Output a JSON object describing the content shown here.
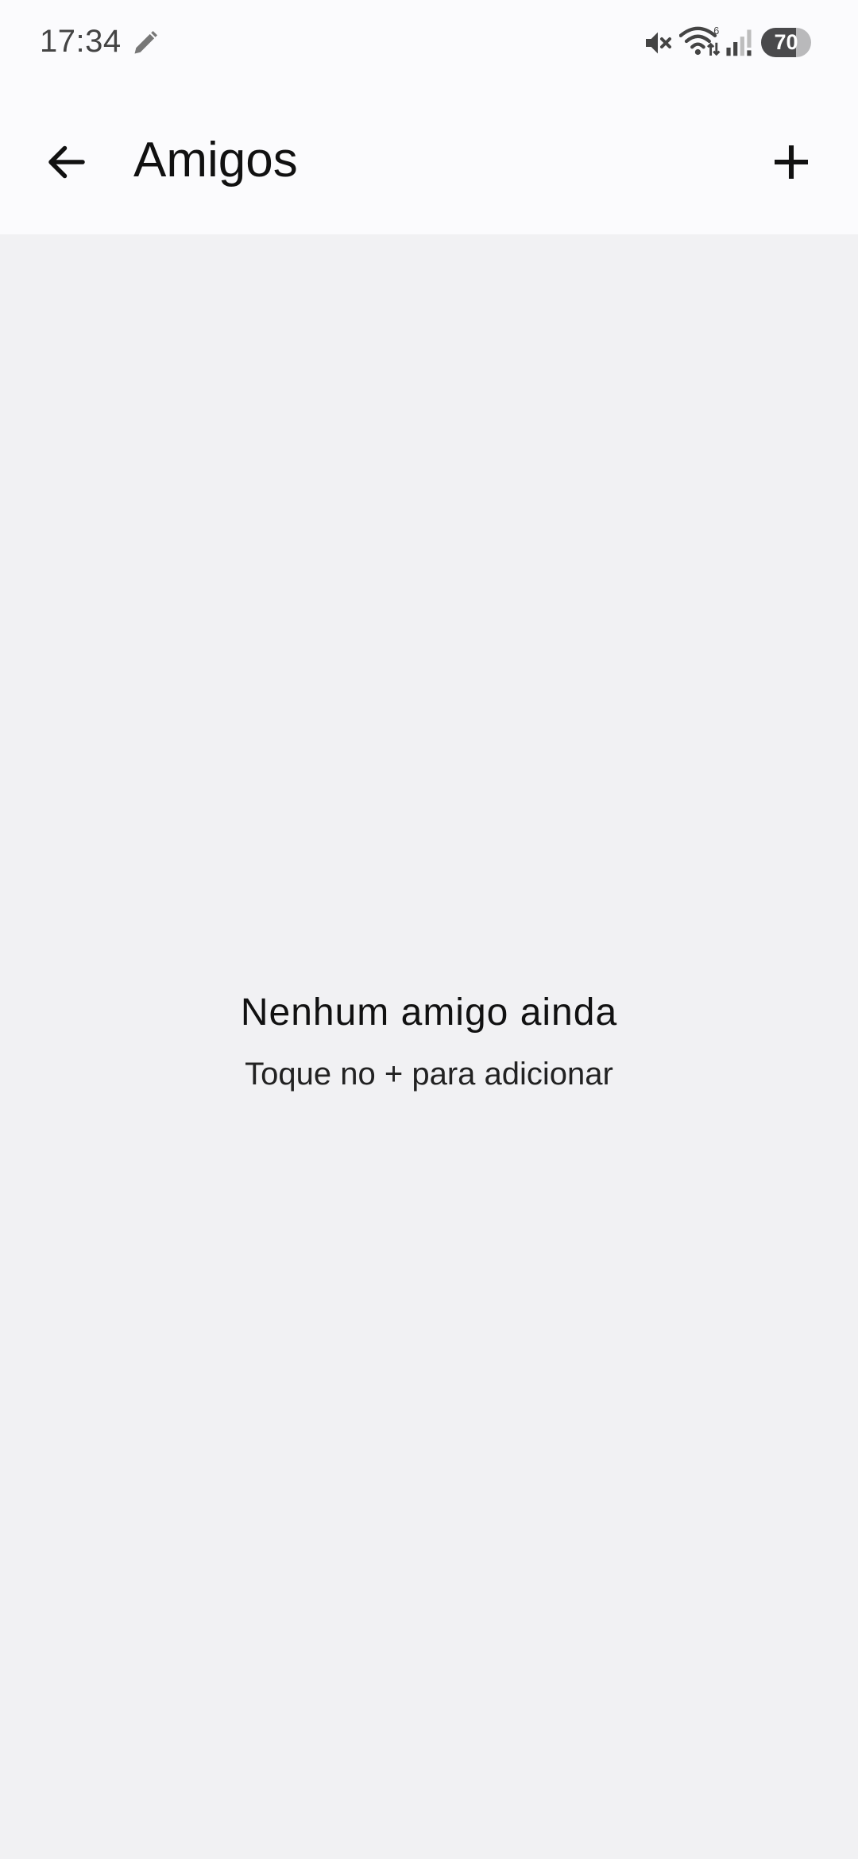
{
  "status_bar": {
    "time": "17:34",
    "battery_level": "70",
    "battery_fraction": 0.7,
    "icons": [
      "pencil-icon",
      "mute-icon",
      "wifi-icon",
      "signal-icon",
      "battery-icon"
    ]
  },
  "app_bar": {
    "title": "Amigos",
    "back_icon": "arrow-back-icon",
    "add_icon": "plus-icon"
  },
  "empty_state": {
    "title": "Nenhum amigo ainda",
    "subtitle": "Toque no + para adicionar"
  },
  "colors": {
    "background": "#f1f1f3",
    "app_bar_background": "#fbfbfd",
    "text": "#111111"
  }
}
